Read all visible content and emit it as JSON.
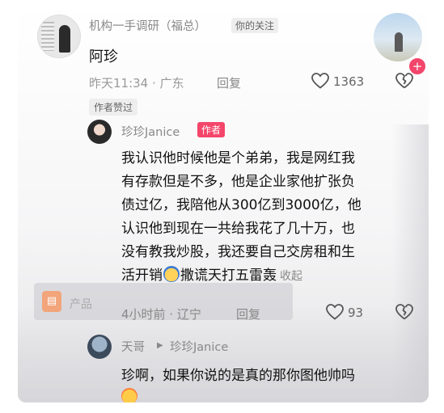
{
  "comment1": {
    "username": "机构一手调研（福总）",
    "follow_tag": "你的关注",
    "text": "阿珍",
    "meta": "昨天11:34 · 广东",
    "reply_label": "回复",
    "like_count": "1363",
    "author_liked": "作者赞过"
  },
  "reply1": {
    "username": "珍珍Janice",
    "author_tag": "作者",
    "lines": [
      "我认识他时候他是个弟弟，我是网红我",
      "有存款但是不多，他是企业家他扩张负",
      "债过亿，我陪他从300亿到3000亿，他",
      "认识他到现在一共给我花了几十万，也",
      "没有教我炒股，我还要自己交房租和生"
    ],
    "last_line_before_emoji": "活开销",
    "last_line_after_emoji": "撒谎天打五雷轰",
    "collapse_label": "收起",
    "meta": "4小时前 · 辽宁",
    "reply_label": "回复",
    "like_count": "93"
  },
  "product_overlay": {
    "label": "产品"
  },
  "reply2": {
    "username": "天哥",
    "reply_to": "珍珍Janice",
    "text": "珍啊，如果你说的是真的那你图他帅吗"
  },
  "colors": {
    "author_tag_bg": "#f4456a",
    "meta_text": "#888888",
    "body_text": "#111111"
  }
}
